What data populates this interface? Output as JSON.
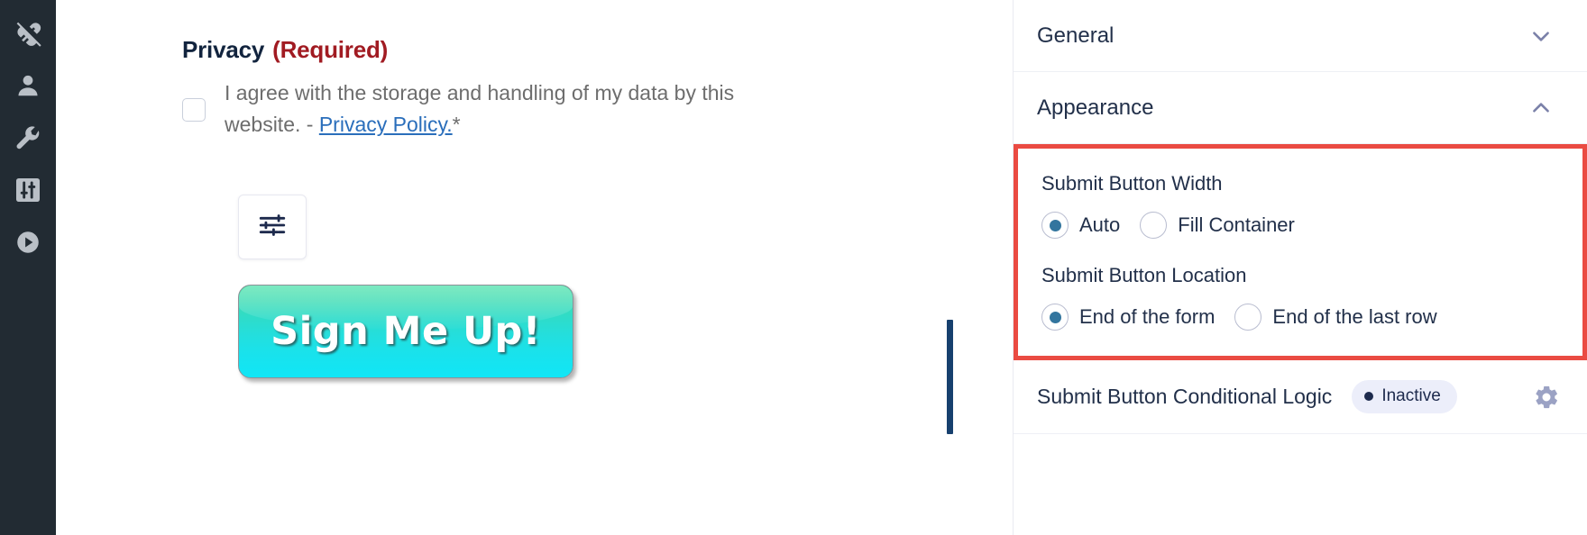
{
  "rail": {
    "items": [
      {
        "name": "plug-disconnected-icon",
        "label": "Integrations"
      },
      {
        "name": "user-icon",
        "label": "User"
      },
      {
        "name": "wrench-icon",
        "label": "Tools"
      },
      {
        "name": "sliders-icon",
        "label": "Settings"
      },
      {
        "name": "play-circle-icon",
        "label": "Preview"
      }
    ]
  },
  "form": {
    "field_label": "Privacy",
    "required_tag": "(Required)",
    "consent_text_before": "I agree with the storage and handling of my data by this website. - ",
    "consent_link": "Privacy Policy.",
    "consent_star": "*",
    "sliders_button_name": "field-settings-button",
    "submit_button_label": "Sign Me Up!"
  },
  "panel": {
    "sections": [
      {
        "title": "General",
        "state": "collapsed",
        "chevron": "chevron-down-icon"
      },
      {
        "title": "Appearance",
        "state": "expanded",
        "chevron": "chevron-up-icon"
      }
    ],
    "appearance": {
      "width_label": "Submit Button Width",
      "width_options": [
        {
          "label": "Auto",
          "selected": true
        },
        {
          "label": "Fill Container",
          "selected": false
        }
      ],
      "location_label": "Submit Button Location",
      "location_options": [
        {
          "label": "End of the form",
          "selected": true
        },
        {
          "label": "End of the last row",
          "selected": false
        }
      ]
    },
    "conditional_logic": {
      "label": "Submit Button Conditional Logic",
      "badge": "Inactive",
      "gear_icon": "gear-icon"
    }
  },
  "colors": {
    "highlight_border": "#ea4b42",
    "rail_bg": "#222b33",
    "required_red": "#a11b22",
    "link_blue": "#2a6ebb",
    "radio_selected": "#33759e",
    "caret_navy": "#17406e",
    "badge_bg": "#eceefa"
  }
}
